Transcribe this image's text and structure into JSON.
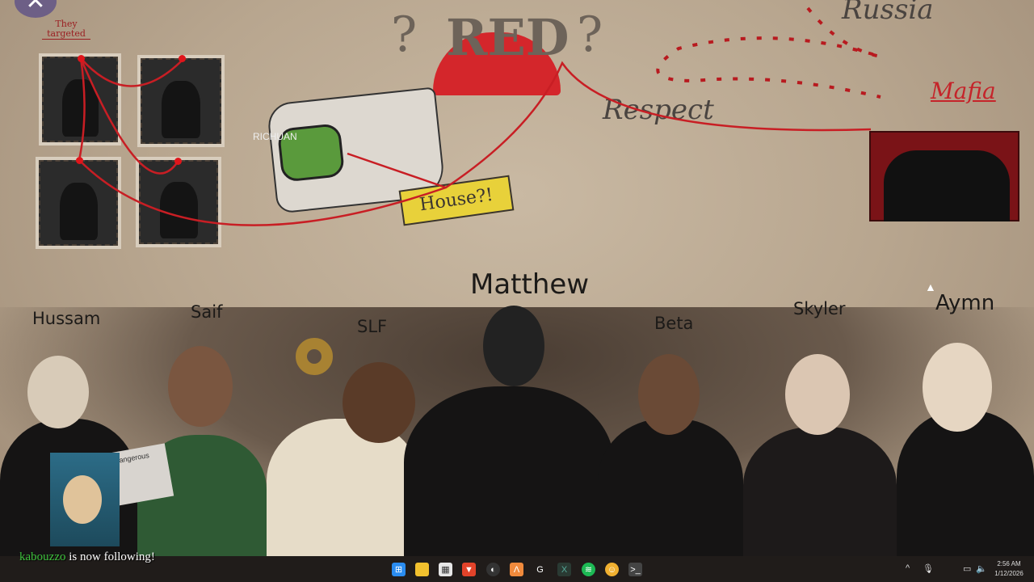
{
  "wallpaper": {
    "title_marks": "?",
    "title": "RED",
    "labels": {
      "they_targeted": "They targeted",
      "russia": "Russia",
      "respect": "Respect",
      "mafia": "Mafia",
      "house": "House?!",
      "map_label": "RICHUAN"
    },
    "characters": [
      "Hussam",
      "Saif",
      "SLF",
      "Matthew",
      "Beta",
      "Skyler",
      "Aymn"
    ],
    "sign_text": "dangerous"
  },
  "overlay": {
    "follower_name": "kabouzzo",
    "follow_text": "is now following!"
  },
  "taskbar": {
    "icons": [
      "windows-start-icon",
      "file-explorer-icon",
      "microsoft-store-icon",
      "brave-browser-icon",
      "obs-icon",
      "app-icon",
      "g-app-icon",
      "excel-icon",
      "spotify-icon",
      "discord-icon",
      "terminal-icon"
    ],
    "tray": {
      "chevron": "^",
      "time": "2:56 AM",
      "date": "1/12/2026"
    }
  },
  "colors": {
    "accent_red": "#d4262b",
    "follower_green": "#3ec33e",
    "taskbar": "#201c1a"
  }
}
